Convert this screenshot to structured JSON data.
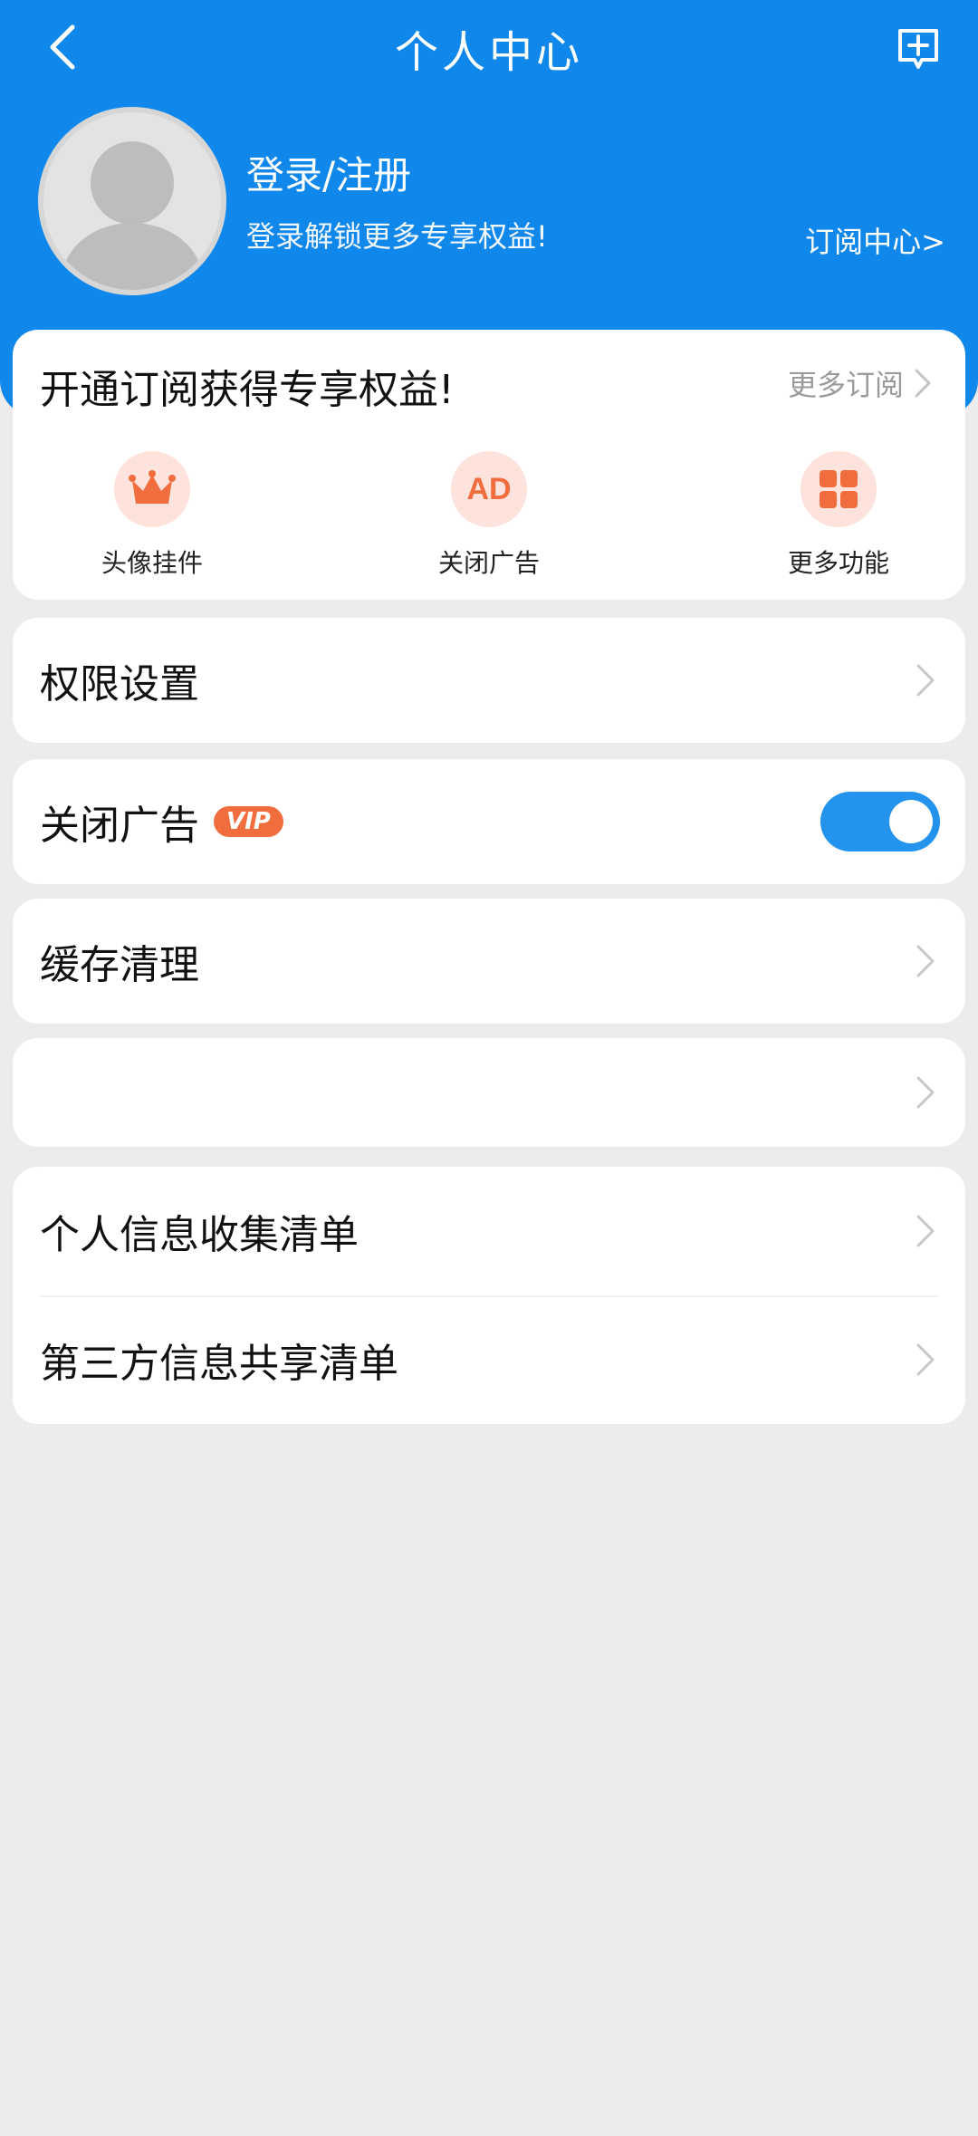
{
  "header": {
    "title": "个人中心",
    "login_title": "登录/注册",
    "login_subtitle": "登录解锁更多专享权益!",
    "subscription_center": "订阅中心>"
  },
  "promo": {
    "title": "开通订阅获得专享权益!",
    "more": "更多订阅",
    "features": [
      {
        "label": "头像挂件",
        "icon": "crown-icon"
      },
      {
        "label": "关闭广告",
        "icon": "ad-icon"
      },
      {
        "label": "更多功能",
        "icon": "grid-icon"
      }
    ],
    "ad_icon_text": "AD"
  },
  "settings": {
    "permissions": "权限设置",
    "close_ads": "关闭广告",
    "vip_badge": "VIP",
    "close_ads_enabled": true,
    "cache_clean": "缓存清理",
    "blank_item": "",
    "personal_info_list": "个人信息收集清单",
    "third_party_list": "第三方信息共享清单"
  },
  "colors": {
    "primary": "#1087ea",
    "accent_orange": "#f26d3d",
    "toggle_on": "#2493ee",
    "background": "#ececec"
  }
}
